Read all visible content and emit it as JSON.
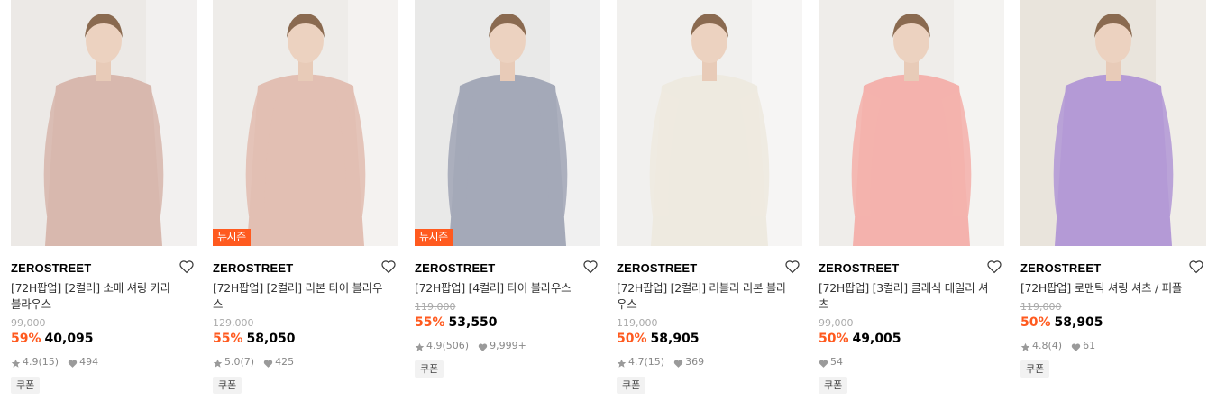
{
  "colors": {
    "accent": "#ff5a1f",
    "muted": "#888888",
    "strike": "#aaaaaa"
  },
  "products": [
    {
      "brand": "ZEROSTREET",
      "name": "[72H팝업] [2컬러] 소매 셔링 카라 블라우스",
      "original_price": "99,000",
      "discount": "59%",
      "price": "40,095",
      "rating": "4.9",
      "reviews": "(15)",
      "likes": "494",
      "badge": "",
      "coupon": "쿠폰",
      "blouse_color": "#d8b8ae",
      "bg_color": "#ece9e6"
    },
    {
      "brand": "ZEROSTREET",
      "name": "[72H팝업] [2컬러] 리본 타이 블라우스",
      "original_price": "129,000",
      "discount": "55%",
      "price": "58,050",
      "rating": "5.0",
      "reviews": "(7)",
      "likes": "425",
      "badge": "뉴시즌",
      "coupon": "쿠폰",
      "blouse_color": "#e2bfb3",
      "bg_color": "#eeece9"
    },
    {
      "brand": "ZEROSTREET",
      "name": "[72H팝업] [4컬러] 타이 블라우스",
      "original_price": "119,000",
      "discount": "55%",
      "price": "53,550",
      "rating": "4.9",
      "reviews": "(506)",
      "likes": "9,999+",
      "badge": "뉴시즌",
      "coupon": "쿠폰",
      "blouse_color": "#a4a9b8",
      "bg_color": "#e9e9e8"
    },
    {
      "brand": "ZEROSTREET",
      "name": "[72H팝업] [2컬러] 러블리 리본 블라우스",
      "original_price": "119,000",
      "discount": "50%",
      "price": "58,905",
      "rating": "4.7",
      "reviews": "(15)",
      "likes": "369",
      "badge": "",
      "coupon": "쿠폰",
      "blouse_color": "#eeeae0",
      "bg_color": "#f1f0ee"
    },
    {
      "brand": "ZEROSTREET",
      "name": "[72H팝업] [3컬러] 클래식 데일리 셔츠",
      "original_price": "99,000",
      "discount": "50%",
      "price": "49,005",
      "rating": "",
      "reviews": "",
      "likes": "54",
      "badge": "",
      "coupon": "쿠폰",
      "blouse_color": "#f4b2ad",
      "bg_color": "#efedea"
    },
    {
      "brand": "ZEROSTREET",
      "name": "[72H팝업] 로맨틱 셔링 셔츠 / 퍼플",
      "original_price": "119,000",
      "discount": "50%",
      "price": "58,905",
      "rating": "4.8",
      "reviews": "(4)",
      "likes": "61",
      "badge": "",
      "coupon": "쿠폰",
      "blouse_color": "#b49ad6",
      "bg_color": "#e9e4dc"
    }
  ]
}
